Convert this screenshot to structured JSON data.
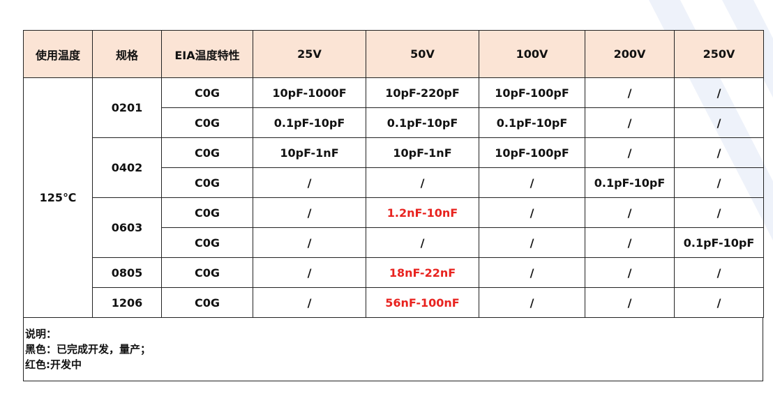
{
  "table": {
    "headers": [
      "使用温度",
      "规格",
      "EIA温度特性",
      "25V",
      "50V",
      "100V",
      "200V",
      "250V"
    ],
    "temperature": "125℃",
    "groups": [
      {
        "size": "0201",
        "rows": [
          {
            "eia": "C0G",
            "cells": [
              {
                "text": "10pF-1000F",
                "status": "black"
              },
              {
                "text": "10pF-220pF",
                "status": "black"
              },
              {
                "text": "10pF-100pF",
                "status": "black"
              },
              {
                "text": "/",
                "status": "black"
              },
              {
                "text": "/",
                "status": "black"
              }
            ]
          },
          {
            "eia": "C0G",
            "cells": [
              {
                "text": "0.1pF-10pF",
                "status": "black"
              },
              {
                "text": "0.1pF-10pF",
                "status": "black"
              },
              {
                "text": "0.1pF-10pF",
                "status": "black"
              },
              {
                "text": "/",
                "status": "black"
              },
              {
                "text": "/",
                "status": "black"
              }
            ]
          }
        ]
      },
      {
        "size": "0402",
        "rows": [
          {
            "eia": "C0G",
            "cells": [
              {
                "text": "10pF-1nF",
                "status": "black"
              },
              {
                "text": "10pF-1nF",
                "status": "black"
              },
              {
                "text": "10pF-100pF",
                "status": "black"
              },
              {
                "text": "/",
                "status": "black"
              },
              {
                "text": "/",
                "status": "black"
              }
            ]
          },
          {
            "eia": "C0G",
            "cells": [
              {
                "text": "/",
                "status": "black"
              },
              {
                "text": "/",
                "status": "black"
              },
              {
                "text": "/",
                "status": "black"
              },
              {
                "text": "0.1pF-10pF",
                "status": "black"
              },
              {
                "text": "/",
                "status": "black"
              }
            ]
          }
        ]
      },
      {
        "size": "0603",
        "rows": [
          {
            "eia": "C0G",
            "cells": [
              {
                "text": "/",
                "status": "black"
              },
              {
                "text": "1.2nF-10nF",
                "status": "red"
              },
              {
                "text": "/",
                "status": "black"
              },
              {
                "text": "/",
                "status": "black"
              },
              {
                "text": "/",
                "status": "black"
              }
            ]
          },
          {
            "eia": "C0G",
            "cells": [
              {
                "text": "/",
                "status": "black"
              },
              {
                "text": "/",
                "status": "black"
              },
              {
                "text": "/",
                "status": "black"
              },
              {
                "text": "/",
                "status": "black"
              },
              {
                "text": "0.1pF-10pF",
                "status": "black"
              }
            ]
          }
        ]
      },
      {
        "size": "0805",
        "rows": [
          {
            "eia": "C0G",
            "cells": [
              {
                "text": "/",
                "status": "black"
              },
              {
                "text": "18nF-22nF",
                "status": "red"
              },
              {
                "text": "/",
                "status": "black"
              },
              {
                "text": "/",
                "status": "black"
              },
              {
                "text": "/",
                "status": "black"
              }
            ]
          }
        ]
      },
      {
        "size": "1206",
        "rows": [
          {
            "eia": "C0G",
            "cells": [
              {
                "text": "/",
                "status": "black"
              },
              {
                "text": "56nF-100nF",
                "status": "red"
              },
              {
                "text": "/",
                "status": "black"
              },
              {
                "text": "/",
                "status": "black"
              },
              {
                "text": "/",
                "status": "black"
              }
            ]
          }
        ]
      }
    ]
  },
  "notes": {
    "title": "说明：",
    "lines": [
      "黑色：已完成开发，量产；",
      "红色:开发中"
    ]
  },
  "colors": {
    "header_bg": "#fbe4d5",
    "in_development": "#e8231f",
    "border": "#222222",
    "deco_stripe": "#eef2fa"
  }
}
